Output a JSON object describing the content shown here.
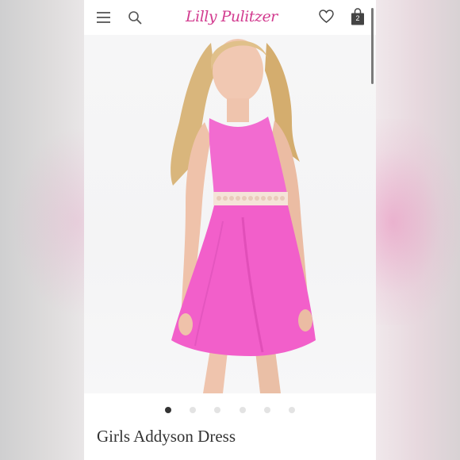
{
  "brand": {
    "logo_text": "Lilly Pulitzer",
    "accent_color": "#d23b8f"
  },
  "header": {
    "icons": [
      "menu-icon",
      "search-icon",
      "heart-icon",
      "shopping-bag-icon"
    ],
    "bag_count": "2"
  },
  "gallery": {
    "total_images": 6,
    "active_index": 0,
    "dress_color": "#f26bd0"
  },
  "product": {
    "title": "Girls Addyson Dress"
  }
}
